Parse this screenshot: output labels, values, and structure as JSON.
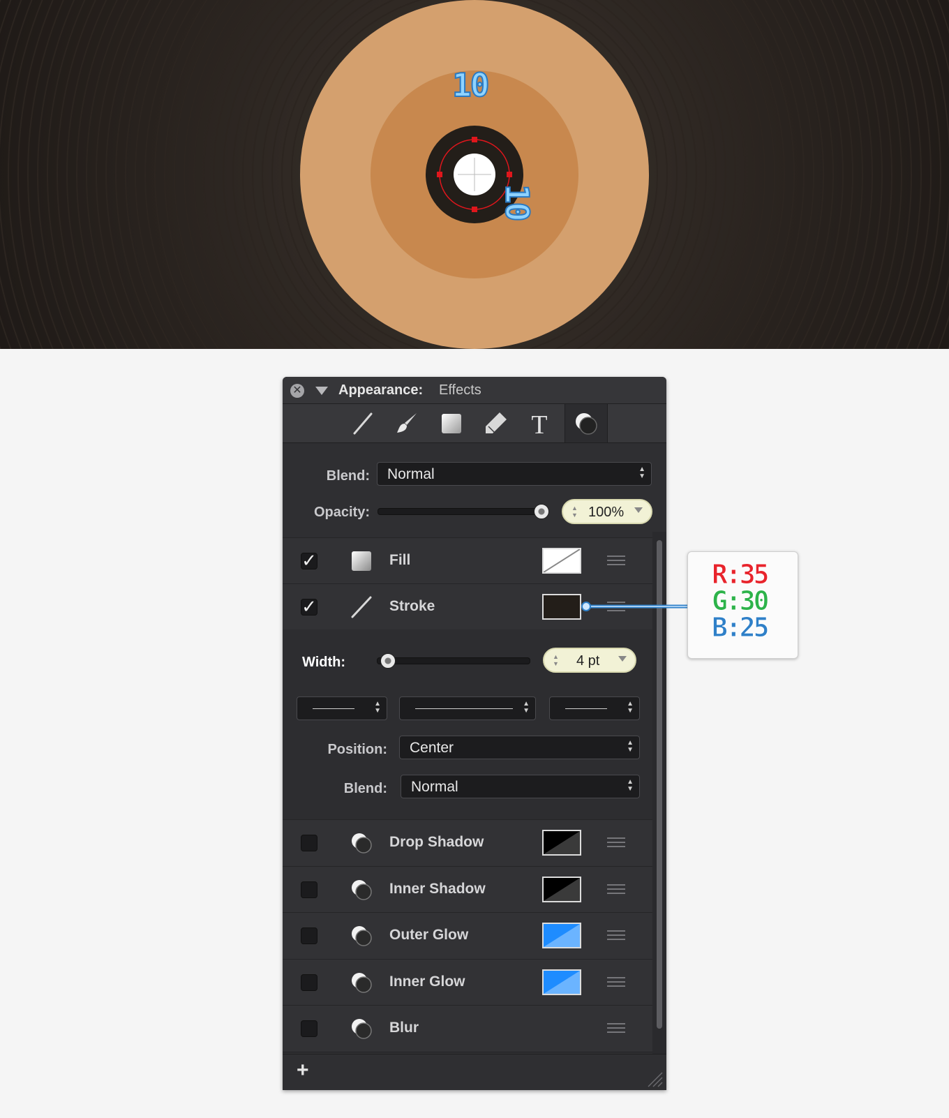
{
  "canvas": {
    "dimension_top": "10",
    "dimension_right": "10",
    "colors": {
      "background": "#231d19",
      "label_outer": "#d4a06e",
      "label_inner": "#c8884e",
      "ring": "#231e19",
      "hole": "#ffffff",
      "guide": "#e0161c"
    }
  },
  "panel": {
    "title": "Appearance:",
    "subtitle": "Effects",
    "toolbar": [
      "line-tool-icon",
      "brush-tool-icon",
      "shape-tool-icon",
      "tag-tool-icon",
      "text-tool-icon",
      "effects-tool-icon"
    ],
    "text_tool_glyph": "T",
    "blend_label": "Blend:",
    "blend_value": "Normal",
    "opacity_label": "Opacity:",
    "opacity_value": "100%",
    "opacity_level": 1.0,
    "fill": {
      "label": "Fill",
      "checked": true,
      "check_glyph": "✓"
    },
    "stroke": {
      "label": "Stroke",
      "checked": true,
      "check_glyph": "✓",
      "color": "#231e19",
      "width_label": "Width:",
      "width_value": "4 pt",
      "position_label": "Position:",
      "position_value": "Center",
      "blend_label": "Blend:",
      "blend_value": "Normal"
    },
    "effects": [
      {
        "label": "Drop Shadow",
        "checked": false,
        "swatch": "#000000"
      },
      {
        "label": "Inner Shadow",
        "checked": false,
        "swatch": "#000000"
      },
      {
        "label": "Outer Glow",
        "checked": false,
        "swatch": "#1e8cff"
      },
      {
        "label": "Inner Glow",
        "checked": false,
        "swatch": "#1e8cff"
      },
      {
        "label": "Blur",
        "checked": false,
        "swatch": ""
      }
    ],
    "add_button": "+"
  },
  "callout": {
    "r": "R:35",
    "g": "G:30",
    "b": "B:25",
    "colors": {
      "r": "#e8242c",
      "g": "#2db34a",
      "b": "#2f80c8"
    }
  }
}
